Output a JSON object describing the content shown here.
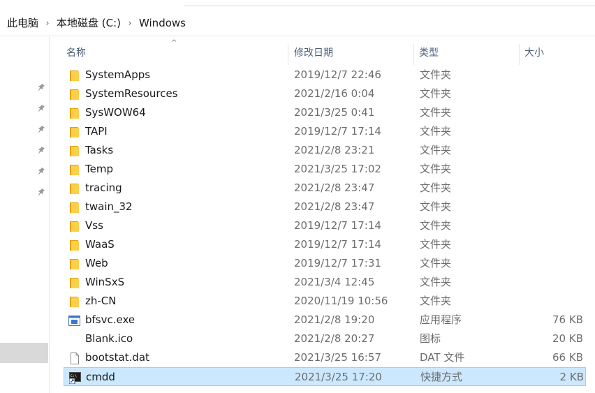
{
  "breadcrumb": [
    "此电脑",
    "本地磁盘 (C:)",
    "Windows"
  ],
  "columns": {
    "name": "名称",
    "date": "修改日期",
    "type": "类型",
    "size": "大小"
  },
  "sort_indicator": "^",
  "files": [
    {
      "name": "SystemApps",
      "date": "2019/12/7 22:46",
      "type": "文件夹",
      "size": "",
      "icon": "folder-icon"
    },
    {
      "name": "SystemResources",
      "date": "2021/2/16 0:04",
      "type": "文件夹",
      "size": "",
      "icon": "folder-icon"
    },
    {
      "name": "SysWOW64",
      "date": "2021/3/25 0:41",
      "type": "文件夹",
      "size": "",
      "icon": "folder-icon"
    },
    {
      "name": "TAPI",
      "date": "2019/12/7 17:14",
      "type": "文件夹",
      "size": "",
      "icon": "folder-icon"
    },
    {
      "name": "Tasks",
      "date": "2021/2/8 23:21",
      "type": "文件夹",
      "size": "",
      "icon": "folder-icon"
    },
    {
      "name": "Temp",
      "date": "2021/3/25 17:02",
      "type": "文件夹",
      "size": "",
      "icon": "folder-icon"
    },
    {
      "name": "tracing",
      "date": "2021/2/8 23:47",
      "type": "文件夹",
      "size": "",
      "icon": "folder-icon"
    },
    {
      "name": "twain_32",
      "date": "2021/2/8 23:47",
      "type": "文件夹",
      "size": "",
      "icon": "folder-icon"
    },
    {
      "name": "Vss",
      "date": "2019/12/7 17:14",
      "type": "文件夹",
      "size": "",
      "icon": "folder-icon"
    },
    {
      "name": "WaaS",
      "date": "2019/12/7 17:14",
      "type": "文件夹",
      "size": "",
      "icon": "folder-icon"
    },
    {
      "name": "Web",
      "date": "2019/12/7 17:31",
      "type": "文件夹",
      "size": "",
      "icon": "folder-icon"
    },
    {
      "name": "WinSxS",
      "date": "2021/3/4 12:45",
      "type": "文件夹",
      "size": "",
      "icon": "folder-icon"
    },
    {
      "name": "zh-CN",
      "date": "2020/11/19 10:56",
      "type": "文件夹",
      "size": "",
      "icon": "folder-icon"
    },
    {
      "name": "bfsvc.exe",
      "date": "2021/2/8 19:20",
      "type": "应用程序",
      "size": "76 KB",
      "icon": "exe-icon"
    },
    {
      "name": "Blank.ico",
      "date": "2021/2/8 20:27",
      "type": "图标",
      "size": "20 KB",
      "icon": "blank-icon"
    },
    {
      "name": "bootstat.dat",
      "date": "2021/3/25 16:57",
      "type": "DAT 文件",
      "size": "66 KB",
      "icon": "file-icon"
    },
    {
      "name": "cmdd",
      "date": "2021/3/25 17:20",
      "type": "快捷方式",
      "size": "2 KB",
      "icon": "shortcut-icon",
      "selected": true
    }
  ],
  "colors": {
    "folder": "#ffcf4a",
    "selection": "#cce8ff",
    "selection_border": "#99d1ff",
    "header_text": "#4c607a"
  }
}
